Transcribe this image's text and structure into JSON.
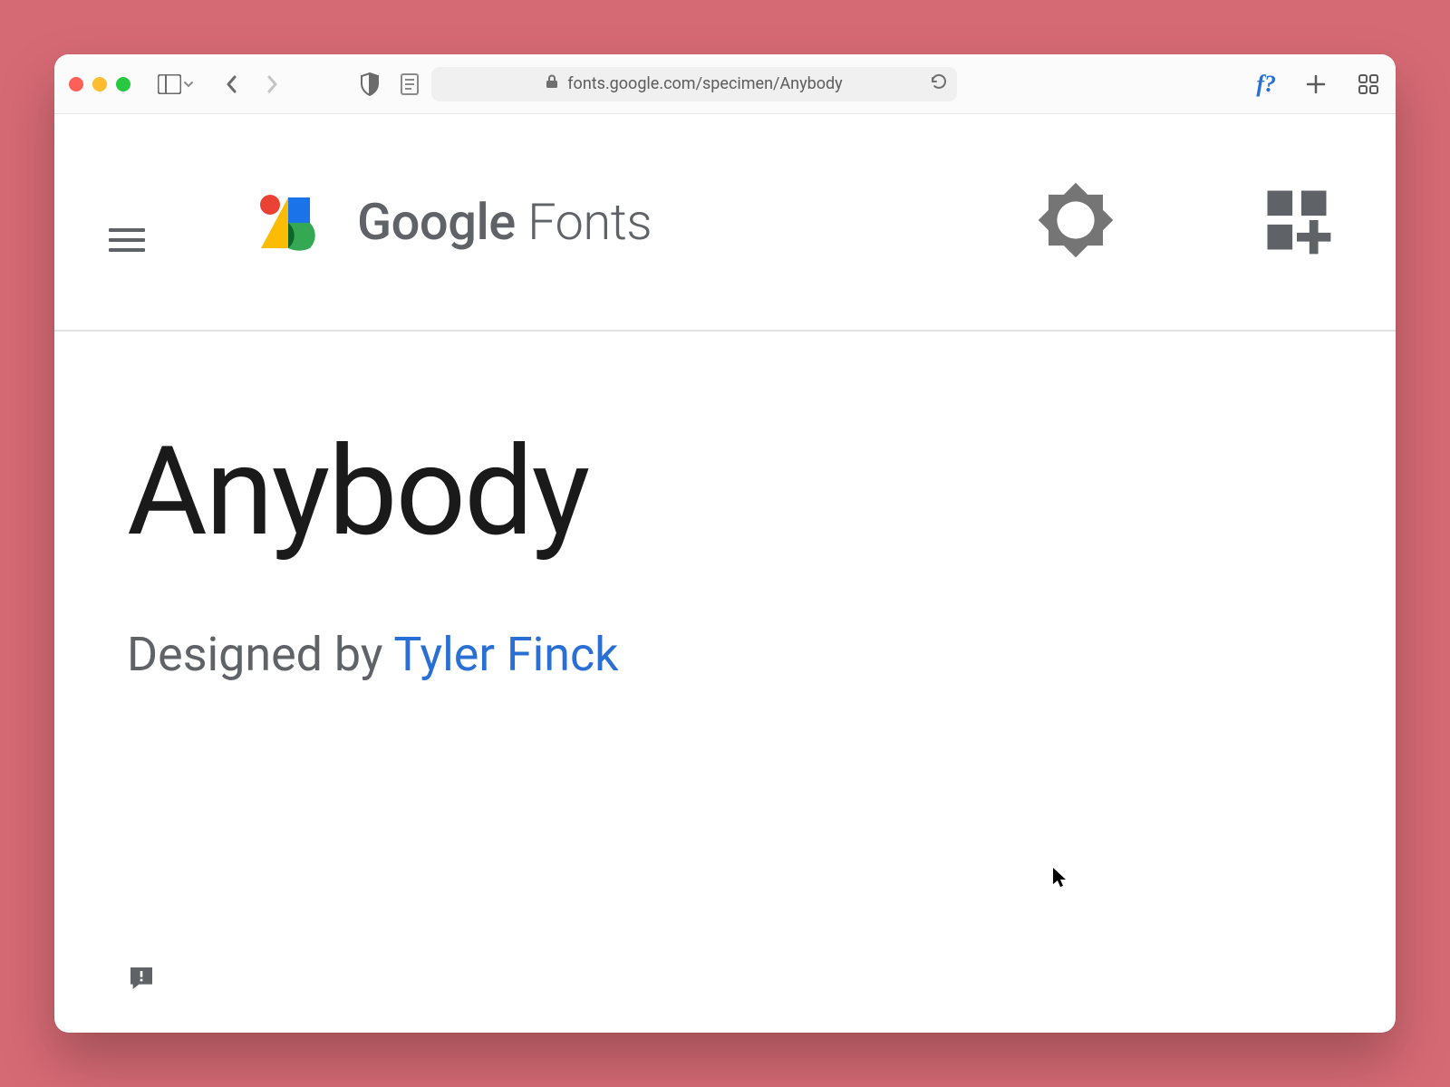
{
  "browser": {
    "url": "fonts.google.com/specimen/Anybody"
  },
  "header": {
    "brand_bold": "Google",
    "brand_thin": "Fonts"
  },
  "page": {
    "font_name": "Anybody",
    "designed_prefix": "Designed by ",
    "designer": "Tyler Finck"
  }
}
